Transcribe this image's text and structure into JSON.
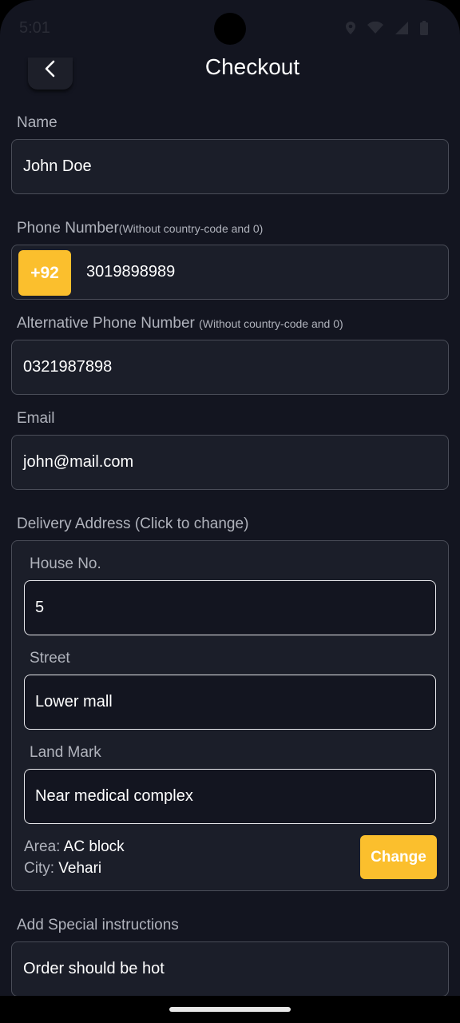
{
  "status_bar": {
    "time": "5:01",
    "icons": [
      "location-icon",
      "wifi-icon",
      "signal-icon",
      "battery-icon"
    ]
  },
  "header": {
    "title": "Checkout",
    "back_icon": "chevron-left-icon"
  },
  "form": {
    "name": {
      "label": "Name",
      "value": "John Doe"
    },
    "phone": {
      "label": "Phone Number",
      "hint": "(Without country-code and 0)",
      "prefix": "+92",
      "value": "3019898989"
    },
    "alt_phone": {
      "label": "Alternative Phone Number",
      "hint": "(Without country-code and 0)",
      "value": "0321987898"
    },
    "email": {
      "label": "Email",
      "value": "john@mail.com"
    },
    "address": {
      "label": "Delivery Address (Click to change)",
      "house": {
        "label": "House No.",
        "value": "5"
      },
      "street": {
        "label": "Street",
        "value": "Lower mall"
      },
      "landmark": {
        "label": "Land Mark",
        "value": "Near medical complex"
      },
      "area_label": "Area:",
      "area_value": "AC block",
      "city_label": "City:",
      "city_value": "Vehari",
      "change_label": "Change"
    },
    "instructions": {
      "label": "Add Special instructions",
      "value": "Order should be hot"
    }
  },
  "colors": {
    "background": "#131520",
    "field_background": "#1b1e29",
    "accent": "#fbbf2d",
    "label": "#b0b3bc"
  }
}
